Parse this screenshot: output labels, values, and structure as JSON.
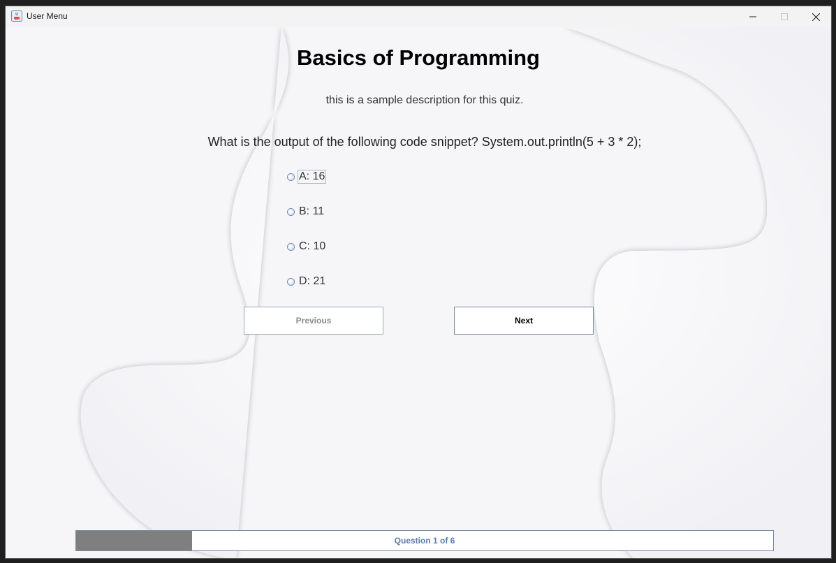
{
  "window": {
    "title": "User Menu",
    "icon": "java-cup-icon",
    "controls": {
      "minimize": "minimize-icon",
      "maximize": "maximize-icon",
      "close": "close-icon"
    }
  },
  "quiz": {
    "title": "Basics of Programming",
    "description": "this is a sample description for this quiz.",
    "question": "What is the output of the following code snippet?  System.out.println(5 + 3 * 2);",
    "options": [
      {
        "label": "A: 16",
        "selected": false
      },
      {
        "label": "B: 11",
        "selected": false
      },
      {
        "label": "C: 10",
        "selected": false
      },
      {
        "label": "D: 21",
        "selected": false
      }
    ],
    "focused_option": 0
  },
  "navigation": {
    "previous_label": "Previous",
    "previous_enabled": false,
    "next_label": "Next",
    "next_enabled": true
  },
  "progress": {
    "text": "Question 1 of 6",
    "current": 1,
    "total": 6,
    "fraction": 0.1667
  },
  "colors": {
    "progress_fill": "#7f7f7f",
    "progress_text": "#5b7bb0",
    "button_border": "#7a8aa0"
  }
}
